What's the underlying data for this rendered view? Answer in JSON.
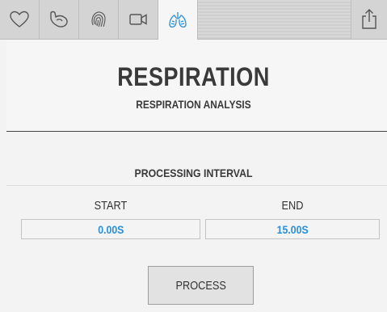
{
  "tabs": [
    {
      "icon": "heart-icon",
      "active": false
    },
    {
      "icon": "arm-icon",
      "active": false
    },
    {
      "icon": "fingerprint-icon",
      "active": false
    },
    {
      "icon": "video-camera-icon",
      "active": false
    },
    {
      "icon": "lungs-icon",
      "active": true
    }
  ],
  "toolbar": {
    "share_icon": "share-icon"
  },
  "header": {
    "title": "RESPIRATION",
    "subtitle": "RESPIRATION ANALYSIS"
  },
  "interval": {
    "title": "PROCESSING INTERVAL",
    "start_label": "START",
    "end_label": "END",
    "start_value": "0.00S",
    "end_value": "15.00S"
  },
  "actions": {
    "process_label": "PROCESS"
  },
  "colors": {
    "accent": "#2a8fd6",
    "active_icon": "#2a8fd6"
  }
}
